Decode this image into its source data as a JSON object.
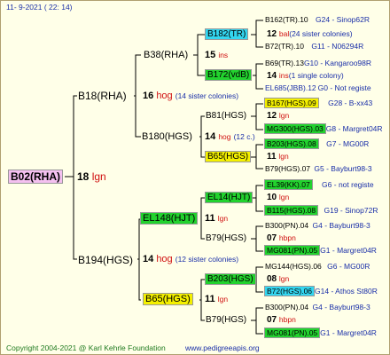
{
  "header": {
    "date": "11-  9-2021 ( 22: 14)"
  },
  "footer": {
    "copyright": "Copyright 2004-2021 @ Karl Kehrle Foundation",
    "site": "www.pedigreeapis.org"
  },
  "root": {
    "name": "B02(RHA)",
    "num": "18",
    "type": "lgn"
  },
  "gen1": [
    {
      "name": "B18(RHA)",
      "num": "16",
      "type": "hog",
      "note": "(14 sister colonies)"
    },
    {
      "name": "B194(HGS)",
      "num": "14",
      "type": "hog",
      "note": "(12 sister colonies)"
    }
  ],
  "gen2": [
    {
      "name": "B38(RHA)",
      "num": "15",
      "type": "ins"
    },
    {
      "name": "B180(HGS)",
      "num": "14",
      "type": "hog",
      "note": "(12 c.)"
    },
    {
      "name": "EL148(HJT)",
      "num": "11",
      "type": "lgn"
    },
    {
      "name": "B65(HGS)",
      "num": "11",
      "type": "lgn"
    }
  ],
  "gen3": [
    {
      "name": "B182(TR)",
      "num": "12",
      "type": "bal",
      "note": "(24 sister colonies)"
    },
    {
      "name": "B172(vdB)",
      "num": "14",
      "type": "ins",
      "note": "(1 single colony)"
    },
    {
      "name": "B81(HGS)",
      "num": "12",
      "type": "lgn"
    },
    {
      "name": "B65(HGS)",
      "num": "11",
      "type": "lgn"
    },
    {
      "name": "EL14(HJT)",
      "num": "10",
      "type": "lgn"
    },
    {
      "name": "B79(HGS)",
      "num": "07",
      "type": "hbpn"
    },
    {
      "name": "B203(HGS)",
      "num": "08",
      "type": "lgn"
    },
    {
      "name": "B79(HGS)",
      "num": "07",
      "type": "hbpn"
    }
  ],
  "gen4": [
    {
      "name": "B162(TR).10",
      "info": "G24 - Sinop62R"
    },
    {
      "name": "B72(TR).10",
      "info": "G11 - N06294R"
    },
    {
      "name": "B69(TR).13",
      "info": "G10 - Kangaroo98R"
    },
    {
      "name": "EL685(JBB).12",
      "info": "G0 - Not registe"
    },
    {
      "name": "B167(HGS).09",
      "info": "G28 - B-xx43"
    },
    {
      "name": "MG300(HGS).03",
      "info": "G8 - Margret04R"
    },
    {
      "name": "B203(HGS).08",
      "info": "G7 - MG00R"
    },
    {
      "name": "B79(HGS).07",
      "info": "G5 - Bayburt98-3"
    },
    {
      "name": "EL39(KK).07",
      "info": "G6 - not registe"
    },
    {
      "name": "B115(HGS).08",
      "info": "G19 - Sinop72R"
    },
    {
      "name": "B300(PN).04",
      "info": "G4 - Bayburt98-3"
    },
    {
      "name": "MG081(PN).05",
      "info": "G1 - Margret04R"
    },
    {
      "name": "MG144(HGS).06",
      "info": "G6 - MG00R"
    },
    {
      "name": "B72(HGS).06",
      "info": "G14 - Athos St80R"
    },
    {
      "name": "B300(PN).04",
      "info": "G4 - Bayburt98-3"
    },
    {
      "name": "MG081(PN).05",
      "info": "G1 - Margret04R"
    }
  ]
}
